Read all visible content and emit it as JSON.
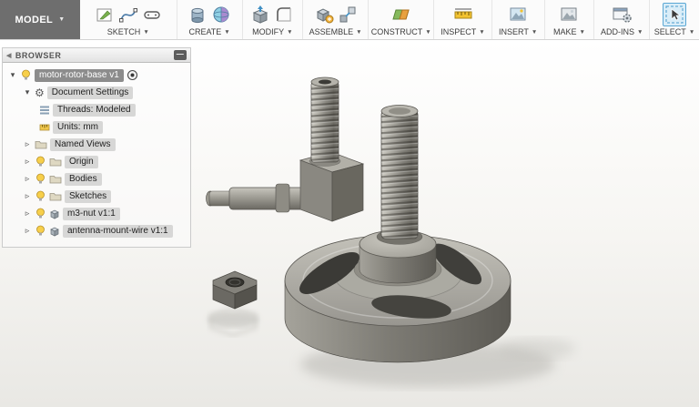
{
  "app": {
    "workspace": "MODEL"
  },
  "icons": {
    "caret": "▼",
    "collapse": "◀",
    "panel_toggle": "—",
    "expanded": "▾",
    "collapsed": "▹",
    "radio": "",
    "gear": "⚙"
  },
  "toolbar": {
    "groups": [
      {
        "label": "SKETCH"
      },
      {
        "label": "CREATE"
      },
      {
        "label": "MODIFY"
      },
      {
        "label": "ASSEMBLE"
      },
      {
        "label": "CONSTRUCT"
      },
      {
        "label": "INSPECT"
      },
      {
        "label": "INSERT"
      },
      {
        "label": "MAKE"
      },
      {
        "label": "ADD-INS"
      },
      {
        "label": "SELECT"
      }
    ]
  },
  "browser": {
    "title": "BROWSER",
    "tree": [
      {
        "label": "motor-rotor-base v1",
        "level": 0,
        "state": "expanded",
        "selected": true,
        "active_component": true
      },
      {
        "label": "Document Settings",
        "level": 1,
        "state": "expanded"
      },
      {
        "label": "Threads: Modeled",
        "level": 2,
        "state": "leaf"
      },
      {
        "label": "Units: mm",
        "level": 2,
        "state": "leaf"
      },
      {
        "label": "Named Views",
        "level": 1,
        "state": "collapsed"
      },
      {
        "label": "Origin",
        "level": 1,
        "state": "collapsed"
      },
      {
        "label": "Bodies",
        "level": 1,
        "state": "collapsed"
      },
      {
        "label": "Sketches",
        "level": 1,
        "state": "collapsed"
      },
      {
        "label": "m3-nut v1:1",
        "level": 1,
        "state": "collapsed"
      },
      {
        "label": "antenna-mount-wire v1:1",
        "level": 1,
        "state": "collapsed"
      }
    ]
  },
  "canvas": {
    "parts": [
      "motor-rotor-base",
      "threaded-shaft",
      "antenna-mount-wire",
      "m3-nut"
    ],
    "colors": {
      "metal_light": "#c9c7bf",
      "metal_mid": "#8b8982",
      "metal_dark": "#5f5d57",
      "select_accent": "#0696d7",
      "bg_top": "#ffffff",
      "bg_bottom": "#e9e8e4"
    }
  }
}
